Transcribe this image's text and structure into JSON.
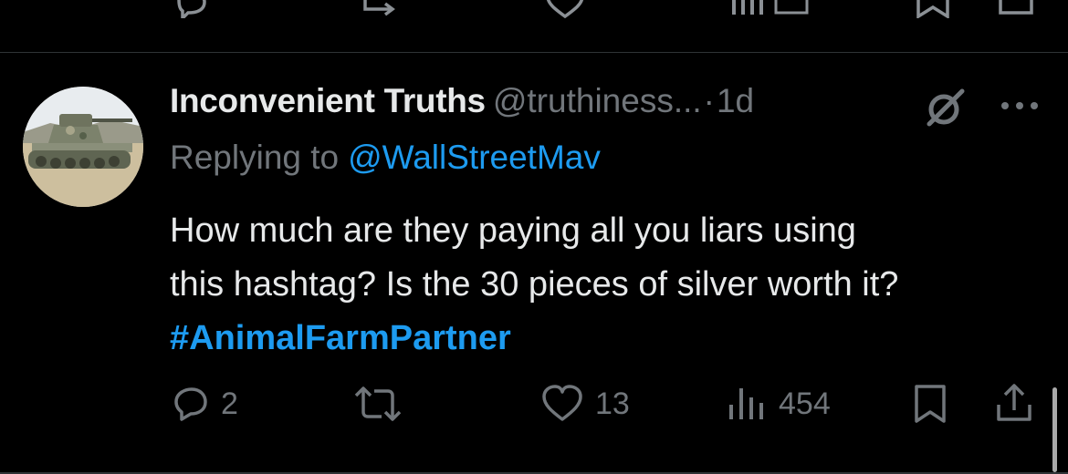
{
  "tweet": {
    "display_name": "Inconvenient Truths",
    "handle": "@truthiness...",
    "separator": "·",
    "time": "1d",
    "reply_prefix": "Replying to",
    "reply_handle": "@WallStreetMav",
    "text_line1": "How much are they paying all you liars using",
    "text_line2": "this hashtag? Is the 30 pieces of silver worth it?",
    "hashtag": "#AnimalFarmPartner"
  },
  "actions": {
    "reply_count": "2",
    "retweet_count": "",
    "like_count": "13",
    "views_count": "454"
  },
  "icons": {
    "avatar": "tank-avatar",
    "grok": "grok-icon",
    "more": "more-icon",
    "reply": "reply-icon",
    "retweet": "retweet-icon",
    "like": "heart-icon",
    "views": "views-icon",
    "bookmark": "bookmark-icon",
    "share": "share-icon"
  },
  "colors": {
    "background": "#000000",
    "text": "#e7e9ea",
    "muted": "#71767b",
    "accent": "#1d9bf0",
    "divider": "#2f3336"
  }
}
